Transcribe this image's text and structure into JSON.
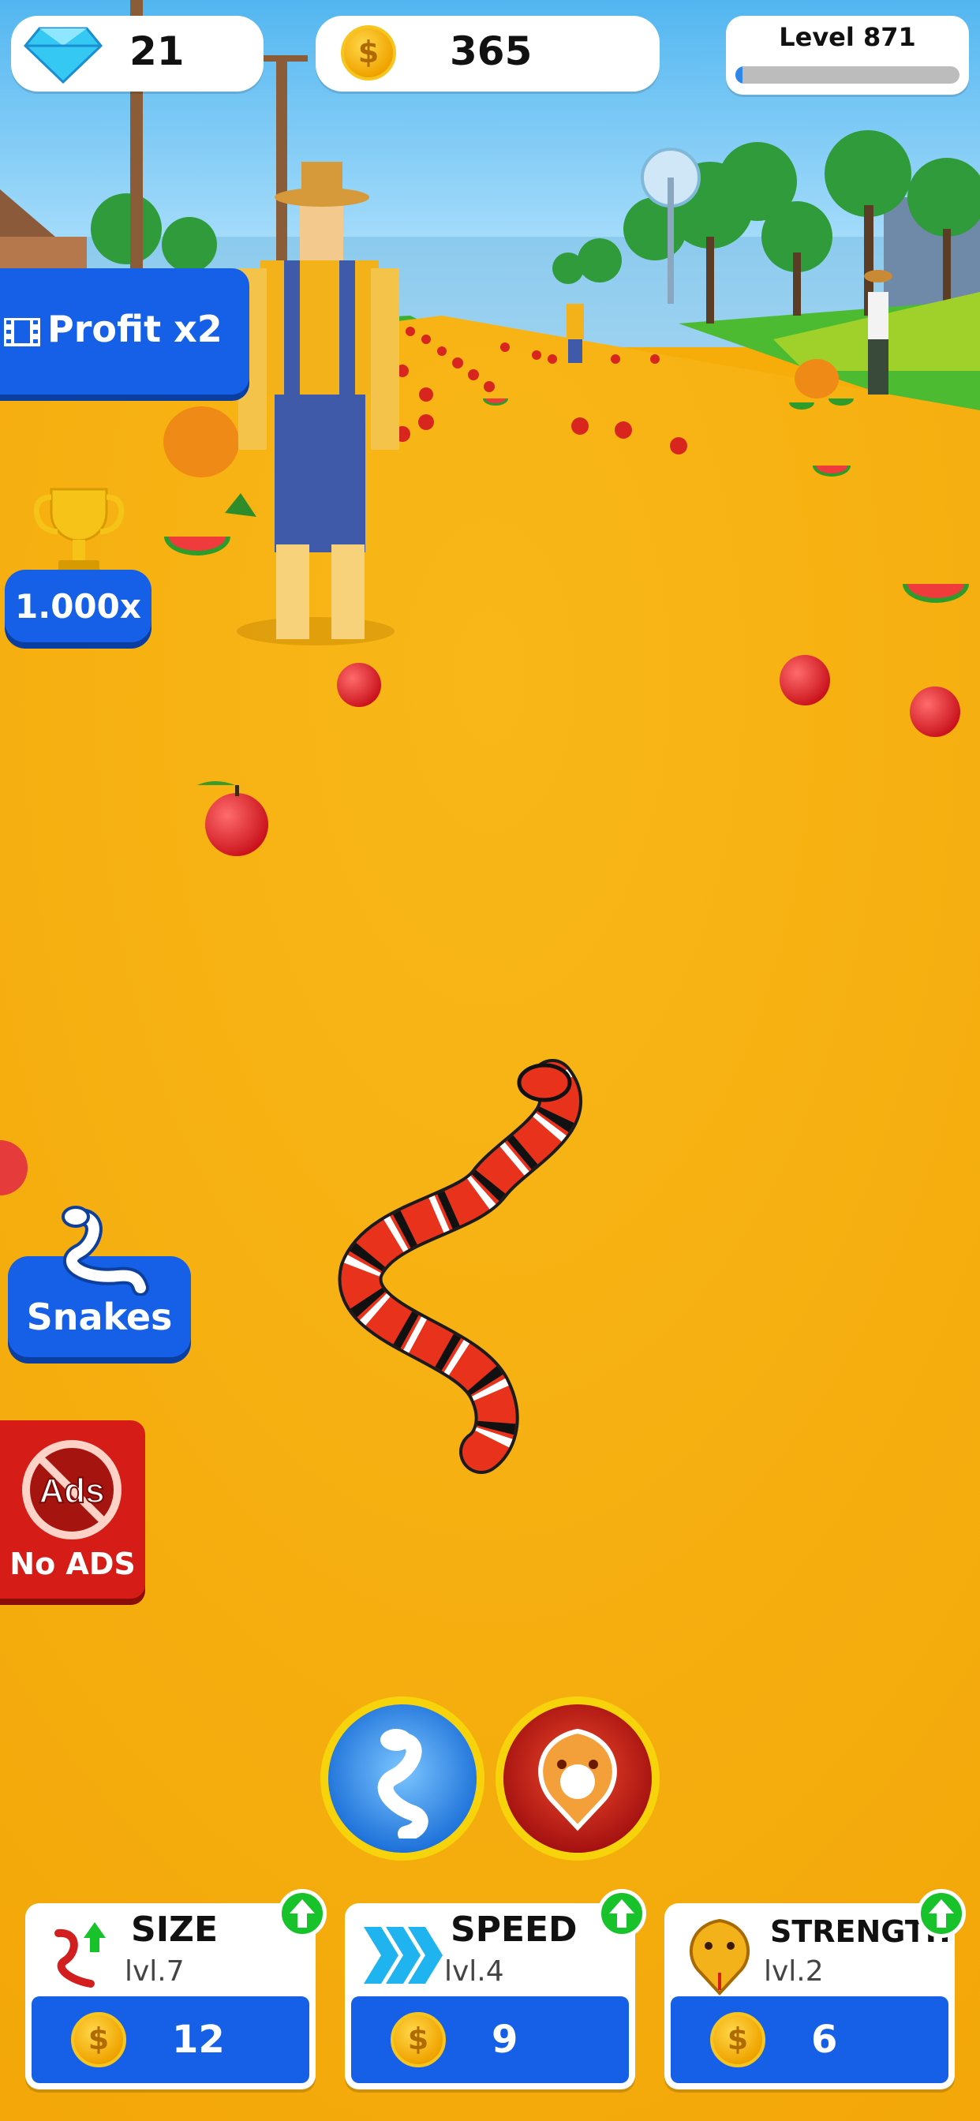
{
  "hud": {
    "gems": "21",
    "coins": "365",
    "level_label": "Level 871",
    "level_progress": 0.03
  },
  "buttons": {
    "profit": "Profit x2",
    "multiplier": "1.000x",
    "snakes": "Snakes",
    "no_ads": "No ADS",
    "ads_icon_text": "Ads"
  },
  "upgrades": [
    {
      "title": "SIZE",
      "level": "lvl.7",
      "price": "12"
    },
    {
      "title": "SPEED",
      "level": "lvl.4",
      "price": "9"
    },
    {
      "title": "STRENGTH",
      "level": "lvl.2",
      "price": "6"
    }
  ],
  "icons": {
    "gem": "diamond-gem-icon",
    "coin": "gold-coin-icon",
    "profit": "video-film-icon",
    "trophy": "trophy-icon",
    "snakes": "white-snake-icon",
    "no_ads": "no-ads-icon",
    "size": "snake-size-up-icon",
    "speed": "speed-chevrons-icon",
    "strength": "cobra-head-icon",
    "upgrade": "green-up-arrow-icon"
  },
  "colors": {
    "ground": "#f6ad0a",
    "button_blue": "#1560e6",
    "no_ads_red": "#d51c16",
    "upgrade_green": "#18c22b",
    "snake_red": "#e8321b"
  }
}
